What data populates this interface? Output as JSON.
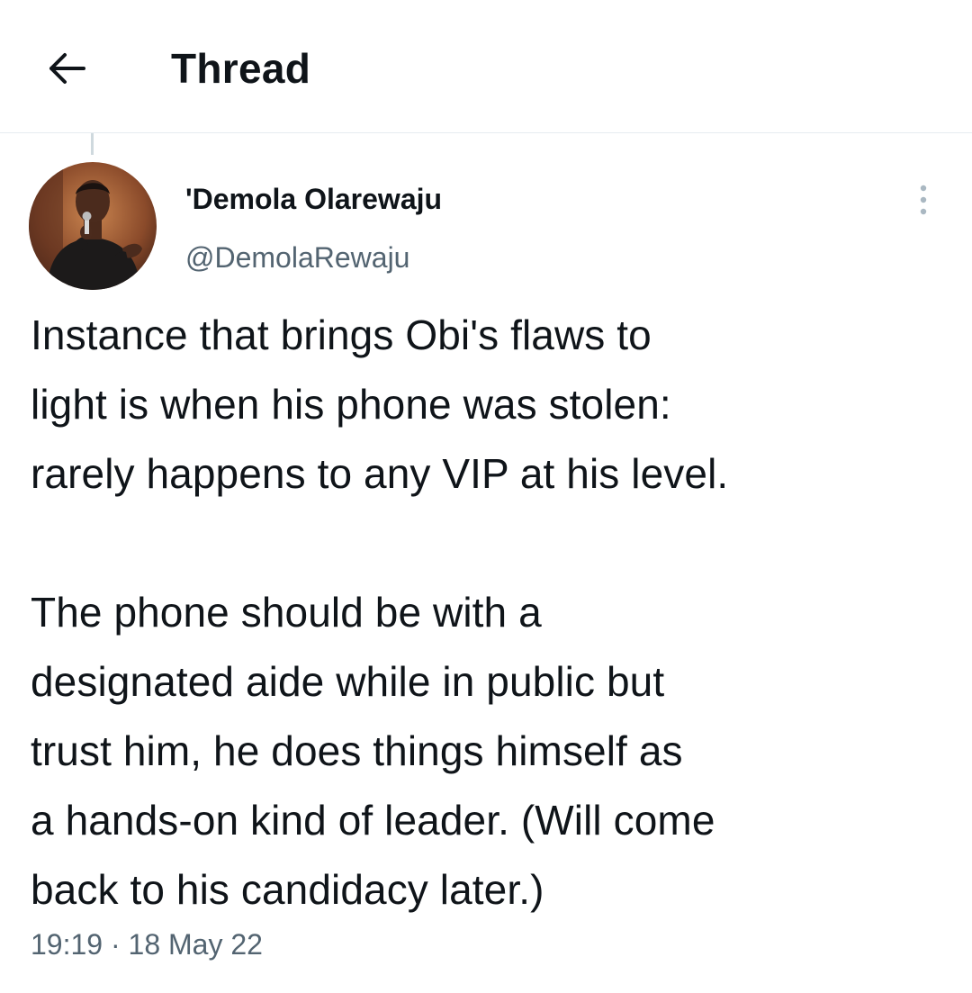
{
  "header": {
    "title": "Thread",
    "back_icon": "arrow-left-icon"
  },
  "tweet": {
    "author": {
      "display_name": "'Demola Olarewaju",
      "handle": "@DemolaRewaju",
      "avatar_icon": "avatar-photo"
    },
    "more_icon": "more-vertical-icon",
    "text": "Instance that brings Obi's flaws to\nlight is when his phone was stolen:\nrarely happens to any VIP at his level.\n\nThe phone should be with a\ndesignated aide while in public but\ntrust him, he does things himself as\na hands-on kind of leader. (Will come\nback to his candidacy later.)",
    "time": "19:19",
    "separator": "·",
    "date": "18 May 22"
  },
  "colors": {
    "text_primary": "#0f1419",
    "text_secondary": "#536471",
    "divider": "#e6ecf0",
    "thread_line": "#cfd9de"
  }
}
